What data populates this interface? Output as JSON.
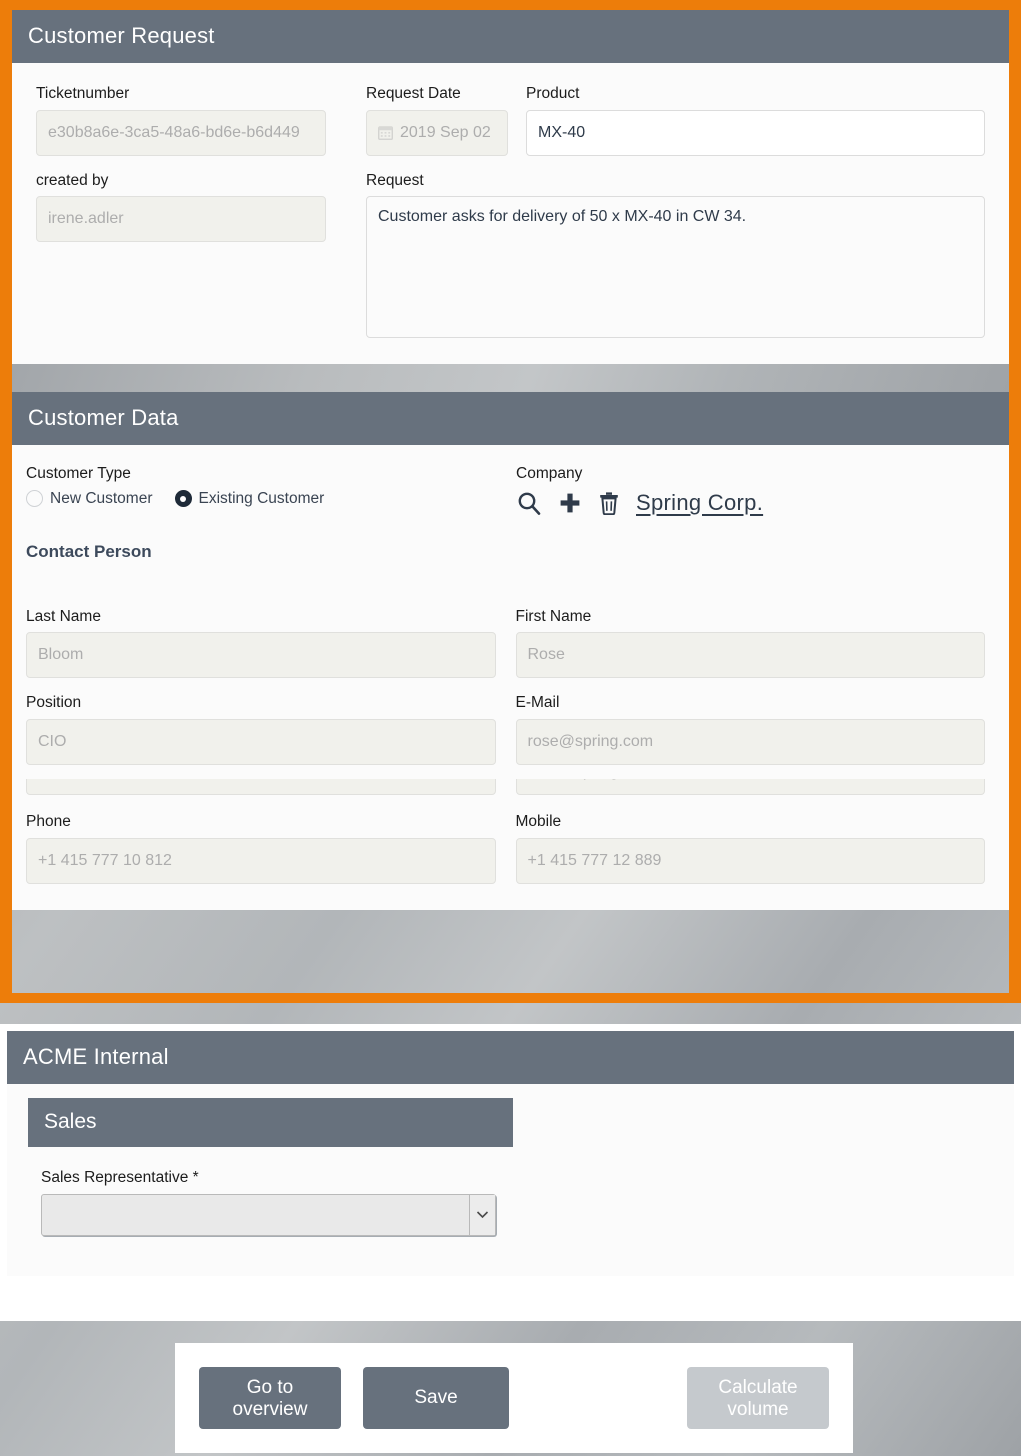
{
  "theme": {
    "accent_orange": "#ed7d0a",
    "header_slate": "#67717d",
    "panel_bg": "#fbfbfb",
    "disabled_field_bg": "#f1f1ec",
    "text_dark": "#2f3b4a",
    "placeholder_gray": "#adadad",
    "disabled_button_bg": "#c5c9cd"
  },
  "customer_request": {
    "title": "Customer Request",
    "ticketnumber": {
      "label": "Ticketnumber",
      "value": "e30b8a6e-3ca5-48a6-bd6e-b6d449",
      "disabled": true
    },
    "request_date": {
      "label": "Request Date",
      "value": "2019 Sep 02",
      "icon": "calendar-icon",
      "disabled": true
    },
    "product": {
      "label": "Product",
      "value": "MX-40",
      "disabled": false
    },
    "created_by": {
      "label": "created by",
      "value": "irene.adler",
      "disabled": true
    },
    "request": {
      "label": "Request",
      "value": "Customer asks for delivery of 50 x MX-40 in CW 34.",
      "disabled": false
    }
  },
  "customer_data": {
    "title": "Customer Data",
    "customer_type": {
      "label": "Customer Type",
      "options": [
        {
          "label": "New Customer",
          "selected": false
        },
        {
          "label": "Existing Customer",
          "selected": true
        }
      ]
    },
    "company": {
      "label": "Company",
      "icons": [
        "search-icon",
        "plus-icon",
        "trash-icon"
      ],
      "value": "Spring Corp."
    },
    "contact_person": {
      "heading": "Contact Person",
      "fields": [
        {
          "label": "Last Name",
          "value": "Bloom"
        },
        {
          "label": "First Name",
          "value": "Rose"
        },
        {
          "label": "Position",
          "value": "CIO"
        },
        {
          "label": "E-Mail",
          "value": "rose@spring.com"
        },
        {
          "label": "Phone",
          "value": "+1 415 777 10 812"
        },
        {
          "label": "Mobile",
          "value": "+1 415 777 12 889"
        }
      ]
    }
  },
  "acme_internal": {
    "title": "ACME Internal",
    "sales": {
      "title": "Sales",
      "sales_representative": {
        "label": "Sales Representative *",
        "value": "",
        "arrow_icon": "chevron-down-icon"
      }
    }
  },
  "actions": {
    "go_to_overview": "Go to\noverview",
    "go_to_overview_line1": "Go to",
    "go_to_overview_line2": "overview",
    "save": "Save",
    "calculate_volume_line1": "Calculate",
    "calculate_volume_line2": "volume"
  }
}
